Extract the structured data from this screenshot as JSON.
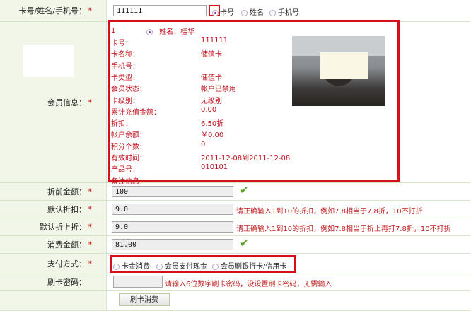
{
  "search": {
    "label": "卡号/姓名/手机号：",
    "required_mark": "*",
    "value": "111111",
    "options": [
      "卡号",
      "姓名",
      "手机号"
    ],
    "selected": "卡号"
  },
  "member": {
    "label": "会员信息：",
    "required_mark": "*",
    "index": "1",
    "name_text": "姓名：桂华",
    "fields": [
      {
        "k": "卡号：",
        "v": "111111"
      },
      {
        "k": "卡名称：",
        "v": "储值卡"
      },
      {
        "k": "手机号：",
        "v": ""
      },
      {
        "k": "卡类型：",
        "v": "储值卡"
      },
      {
        "k": "会员状态：",
        "v": "帐户已禁用"
      },
      {
        "k": "卡级别：",
        "v": "无级别"
      },
      {
        "k": "累计充值金额：",
        "v": "0.00"
      },
      {
        "k": "折扣：",
        "v": "6.50折"
      },
      {
        "k": "帐户余额：",
        "v": "￥0.00"
      },
      {
        "k": "积分个数：",
        "v": "0"
      },
      {
        "k": "有效时间：",
        "v": "2011-12-08到2011-12-08"
      },
      {
        "k": "产品号：",
        "v": "010101"
      },
      {
        "k": "备注信息：",
        "v": ""
      }
    ]
  },
  "pre_discount": {
    "label": "折前金额：",
    "required_mark": "*",
    "value": "100"
  },
  "default_discount": {
    "label": "默认折扣：",
    "required_mark": "*",
    "value": "9.0",
    "hint": "请正确输入1到10的折扣，例如7.8相当于7.8折，10不打折"
  },
  "extra_discount": {
    "label": "默认折上折：",
    "required_mark": "*",
    "value": "9.0",
    "hint": "请正确输入1到10的折扣，例如7.8相当于折上再打7.8折，10不打折"
  },
  "consume": {
    "label": "消费金额：",
    "required_mark": "*",
    "value": "81.00"
  },
  "payment": {
    "label": "支付方式：",
    "required_mark": "*",
    "options": [
      "卡金消费",
      "会员支付现金",
      "会员刷银行卡/信用卡"
    ],
    "selected": "卡金消费"
  },
  "password": {
    "label": "刷卡密码：",
    "value": "",
    "hint": "请输入6位数字刷卡密码，没设置刷卡密码，无需输入"
  },
  "submit": {
    "label": "刷卡消费"
  },
  "colors": {
    "accent_red": "#d4101e",
    "label_bg": "#f1f6e8",
    "check_green": "#56a51e"
  }
}
